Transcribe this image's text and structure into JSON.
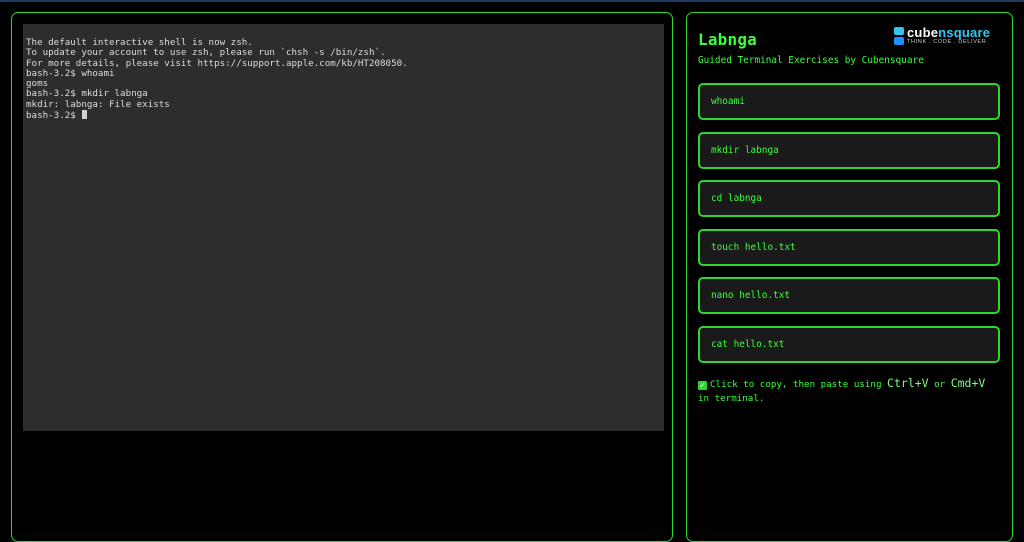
{
  "terminal": {
    "lines": [
      "The default interactive shell is now zsh.",
      "To update your account to use zsh, please run `chsh -s /bin/zsh`.",
      "For more details, please visit https://support.apple.com/kb/HT208050.",
      "bash-3.2$ whoami",
      "goms",
      "bash-3.2$ mkdir labnga",
      "mkdir: labnga: File exists"
    ],
    "prompt": "bash-3.2$ "
  },
  "sidebar": {
    "title": "Labnga",
    "subtitle": "Guided Terminal Exercises by Cubensquare",
    "logo": {
      "name_part1": "cube",
      "name_part2": "nsquare",
      "tagline": "THINK . CODE . DELIVER"
    },
    "commands": [
      "whoami",
      "mkdir labnga",
      "cd labnga",
      "touch hello.txt",
      "nano hello.txt",
      "cat hello.txt"
    ],
    "hint": {
      "check": "✓",
      "text_before": "Click to copy, then paste using ",
      "key1": "Ctrl+V",
      "or": " or ",
      "key2": "Cmd+V",
      "text_after": " in terminal."
    }
  },
  "colors": {
    "accent": "#39ff3c",
    "border": "#2bd82b",
    "terminal_bg": "#2d2d2d",
    "page_bg": "#000000"
  }
}
